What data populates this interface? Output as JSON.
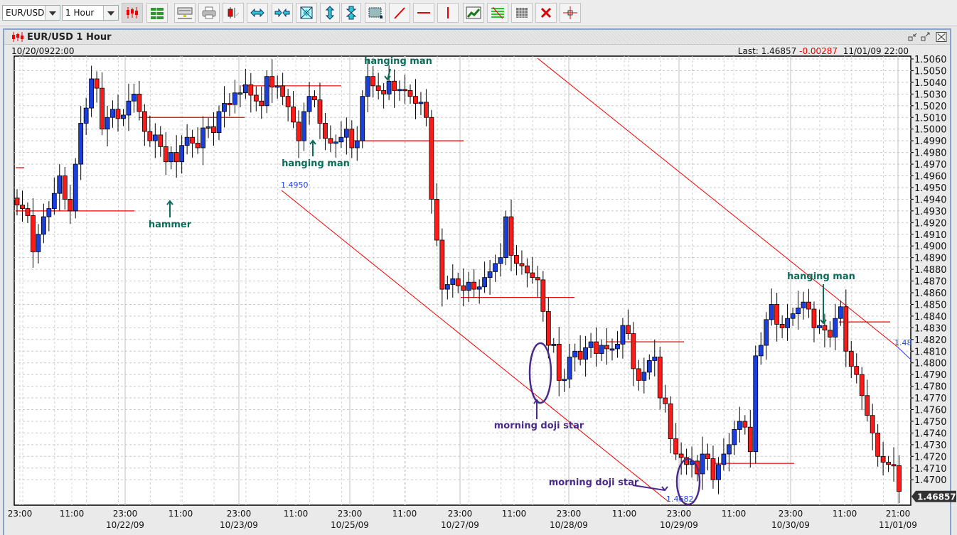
{
  "toolbar": {
    "symbol": "EUR/USD",
    "timeframe": "1 Hour",
    "buttons": [
      {
        "name": "candlestick-chart-icon",
        "active": true
      },
      {
        "name": "table-view-icon"
      },
      {
        "name": "network-icon"
      },
      {
        "name": "print-icon"
      },
      {
        "name": "indicator-icon"
      },
      {
        "name": "expand-horizontal-icon"
      },
      {
        "name": "compress-horizontal-icon"
      },
      {
        "name": "fit-to-window-icon"
      },
      {
        "name": "expand-vertical-icon"
      },
      {
        "name": "compress-vertical-icon"
      },
      {
        "name": "zoom-box-icon"
      },
      {
        "name": "trend-line-icon"
      },
      {
        "name": "horizontal-line-icon"
      },
      {
        "name": "vertical-line-icon"
      },
      {
        "name": "trend-chart-icon"
      },
      {
        "name": "fibonacci-icon"
      },
      {
        "name": "grid-icon"
      },
      {
        "name": "delete-icon"
      },
      {
        "name": "crosshair-icon"
      }
    ]
  },
  "window": {
    "title": "EUR/USD 1 Hour",
    "start_label": "10/20/0922:00",
    "last_label": "Last:",
    "last_price": "1.46857",
    "change": "-0.00287",
    "last_time": "11/01/09 22:00"
  },
  "chart_data": {
    "type": "candlestick",
    "title": "EUR/USD 1 Hour",
    "ylim": [
      1.468,
      1.5065
    ],
    "y_ticks": [
      "1.5060",
      "1.5050",
      "1.5040",
      "1.5030",
      "1.5020",
      "1.5010",
      "1.5000",
      "1.4990",
      "1.4980",
      "1.4970",
      "1.4960",
      "1.4950",
      "1.4940",
      "1.4930",
      "1.4920",
      "1.4910",
      "1.4900",
      "1.4890",
      "1.4880",
      "1.4870",
      "1.4860",
      "1.4850",
      "1.4840",
      "1.4830",
      "1.4820",
      "1.4810",
      "1.4800",
      "1.4790",
      "1.4780",
      "1.4770",
      "1.4760",
      "1.4750",
      "1.4740",
      "1.4730",
      "1.4720",
      "1.4710",
      "1.4700"
    ],
    "x_ticks": [
      {
        "time": "23:00",
        "date": ""
      },
      {
        "time": "11:00",
        "date": ""
      },
      {
        "time": "23:00",
        "date": "10/22/09"
      },
      {
        "time": "11:00",
        "date": ""
      },
      {
        "time": "23:00",
        "date": "10/23/09"
      },
      {
        "time": "11:00",
        "date": ""
      },
      {
        "time": "23:00",
        "date": "10/25/09"
      },
      {
        "time": "11:00",
        "date": ""
      },
      {
        "time": "23:00",
        "date": "10/27/09"
      },
      {
        "time": "11:00",
        "date": ""
      },
      {
        "time": "23:00",
        "date": "10/28/09"
      },
      {
        "time": "11:00",
        "date": ""
      },
      {
        "time": "23:00",
        "date": "10/29/09"
      },
      {
        "time": "11:00",
        "date": ""
      },
      {
        "time": "23:00",
        "date": "10/30/09"
      },
      {
        "time": "11:00",
        "date": ""
      },
      {
        "time": "21:00",
        "date": "11/01/09"
      }
    ],
    "current_price_label": "1.46857",
    "up_color": "#1a3fe0",
    "down_color": "#ff1a1a",
    "closes": [
      1.4935,
      1.4932,
      1.4926,
      1.4895,
      1.491,
      1.4925,
      1.4932,
      1.4945,
      1.496,
      1.494,
      1.493,
      1.497,
      1.5005,
      1.5018,
      1.5043,
      1.5035,
      1.5,
      1.501,
      1.5017,
      1.5009,
      1.5012,
      1.5024,
      1.503,
      1.5015,
      1.4998,
      1.499,
      1.4995,
      1.4985,
      1.4972,
      1.498,
      1.4972,
      1.4986,
      1.4993,
      1.4988,
      1.4984,
      1.5001,
      1.5002,
      1.4997,
      1.5015,
      1.5022,
      1.5021,
      1.5031,
      1.5031,
      1.5038,
      1.5029,
      1.5024,
      1.502,
      1.5045,
      1.5036,
      1.5037,
      1.5028,
      1.5019,
      1.5006,
      1.499,
      1.5015,
      1.5028,
      1.5025,
      1.5005,
      1.4992,
      1.4988,
      1.4989,
      1.4993,
      1.5,
      1.4984,
      1.499,
      1.5028,
      1.5045,
      1.5037,
      1.5033,
      1.503,
      1.5041,
      1.5033,
      1.5034,
      1.5033,
      1.5028,
      1.5022,
      1.5023,
      1.501,
      1.494,
      1.4905,
      1.4863,
      1.4867,
      1.4872,
      1.4866,
      1.4862,
      1.4869,
      1.4863,
      1.4865,
      1.4873,
      1.4878,
      1.4885,
      1.489,
      1.4925,
      1.4892,
      1.4885,
      1.4883,
      1.4877,
      1.4873,
      1.4871,
      1.4844,
      1.4815,
      1.4816,
      1.4785,
      1.4786,
      1.4805,
      1.481,
      1.4803,
      1.4813,
      1.4818,
      1.4808,
      1.4815,
      1.4812,
      1.4812,
      1.4816,
      1.4832,
      1.4825,
      1.4795,
      1.4785,
      1.4792,
      1.4802,
      1.4805,
      1.477,
      1.4765,
      1.4735,
      1.4722,
      1.4719,
      1.4713,
      1.4716,
      1.4705,
      1.4722,
      1.4718,
      1.47,
      1.4713,
      1.4722,
      1.473,
      1.4743,
      1.475,
      1.4745,
      1.4724,
      1.4806,
      1.4815,
      1.4837,
      1.485,
      1.4833,
      1.483,
      1.4838,
      1.4842,
      1.4847,
      1.4852,
      1.4846,
      1.483,
      1.4832,
      1.4828,
      1.4822,
      1.4838,
      1.4848,
      1.481,
      1.4797,
      1.479,
      1.4772,
      1.4755,
      1.474,
      1.472,
      1.4715,
      1.4713,
      1.4712,
      1.469
    ],
    "annotations": [
      {
        "text": "hammer",
        "color": "#0d6b5a"
      },
      {
        "text": "hanging man",
        "color": "#0d6b5a"
      },
      {
        "text": "hanging man",
        "color": "#0d6b5a"
      },
      {
        "text": "morning doji star",
        "color": "#4a2a8a"
      },
      {
        "text": "morning doji star",
        "color": "#4a2a8a"
      },
      {
        "text": "hanging man",
        "color": "#0d6b5a"
      }
    ],
    "line_labels": [
      "1.4950",
      "1.4682",
      "1.48"
    ],
    "support_levels": [
      1.493,
      1.501,
      1.5037,
      1.499,
      1.4856,
      1.4818,
      1.4714,
      1.4835,
      1.4967
    ]
  }
}
